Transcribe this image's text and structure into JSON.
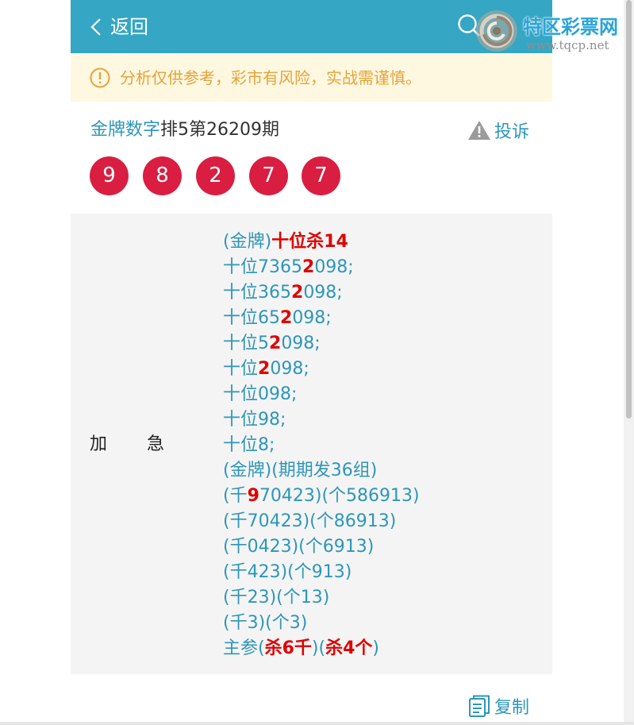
{
  "header": {
    "back_label": "返回"
  },
  "watermark": {
    "title": "特区彩票网",
    "url": "www.tqcp.net"
  },
  "notice": {
    "text": "分析仅供参考，彩市有风险，实战需谨慎。"
  },
  "title": {
    "source": "金牌数字",
    "issue": "排5第26209期"
  },
  "report_label": "投诉",
  "balls": [
    "9",
    "8",
    "2",
    "7",
    "7"
  ],
  "analysis": {
    "label_left": "加",
    "label_right": "急",
    "lines": [
      [
        {
          "t": "(金牌)"
        },
        {
          "t": "十位杀14",
          "hl": true
        }
      ],
      [
        {
          "t": "十位7365"
        },
        {
          "t": "2",
          "hl": true
        },
        {
          "t": "098;"
        }
      ],
      [
        {
          "t": "十位365"
        },
        {
          "t": "2",
          "hl": true
        },
        {
          "t": "098;"
        }
      ],
      [
        {
          "t": "十位65"
        },
        {
          "t": "2",
          "hl": true
        },
        {
          "t": "098;"
        }
      ],
      [
        {
          "t": "十位5"
        },
        {
          "t": "2",
          "hl": true
        },
        {
          "t": "098;"
        }
      ],
      [
        {
          "t": "十位"
        },
        {
          "t": "2",
          "hl": true
        },
        {
          "t": "098;"
        }
      ],
      [
        {
          "t": "十位098;"
        }
      ],
      [
        {
          "t": "十位98;"
        }
      ],
      [
        {
          "t": "十位8;"
        }
      ],
      [
        {
          "t": "(金牌)(期期发36组)"
        }
      ],
      [
        {
          "t": "(千"
        },
        {
          "t": "9",
          "hl": true
        },
        {
          "t": "70423)(个586913)"
        }
      ],
      [
        {
          "t": "(千70423)(个86913)"
        }
      ],
      [
        {
          "t": "(千0423)(个6913)"
        }
      ],
      [
        {
          "t": "(千423)(个913)"
        }
      ],
      [
        {
          "t": "(千23)(个13)"
        }
      ],
      [
        {
          "t": "(千3)(个3)"
        }
      ],
      [
        {
          "t": "主参("
        },
        {
          "t": "杀6千",
          "hl": true
        },
        {
          "t": ")("
        },
        {
          "t": "杀4个",
          "hl": true
        },
        {
          "t": ")"
        }
      ]
    ]
  },
  "copy_label": "复制",
  "colors": {
    "header_bg": "#35a6c3",
    "ball_bg": "#d91e41",
    "text_accent": "#2e96b8",
    "highlight": "#e00000",
    "notice_text": "#e7a23b",
    "notice_bg": "#fef8e0"
  },
  "icons": {
    "back": "chevron-left-icon",
    "search": "search-icon",
    "notice": "info-icon",
    "report": "warning-icon",
    "copy": "copy-icon"
  }
}
